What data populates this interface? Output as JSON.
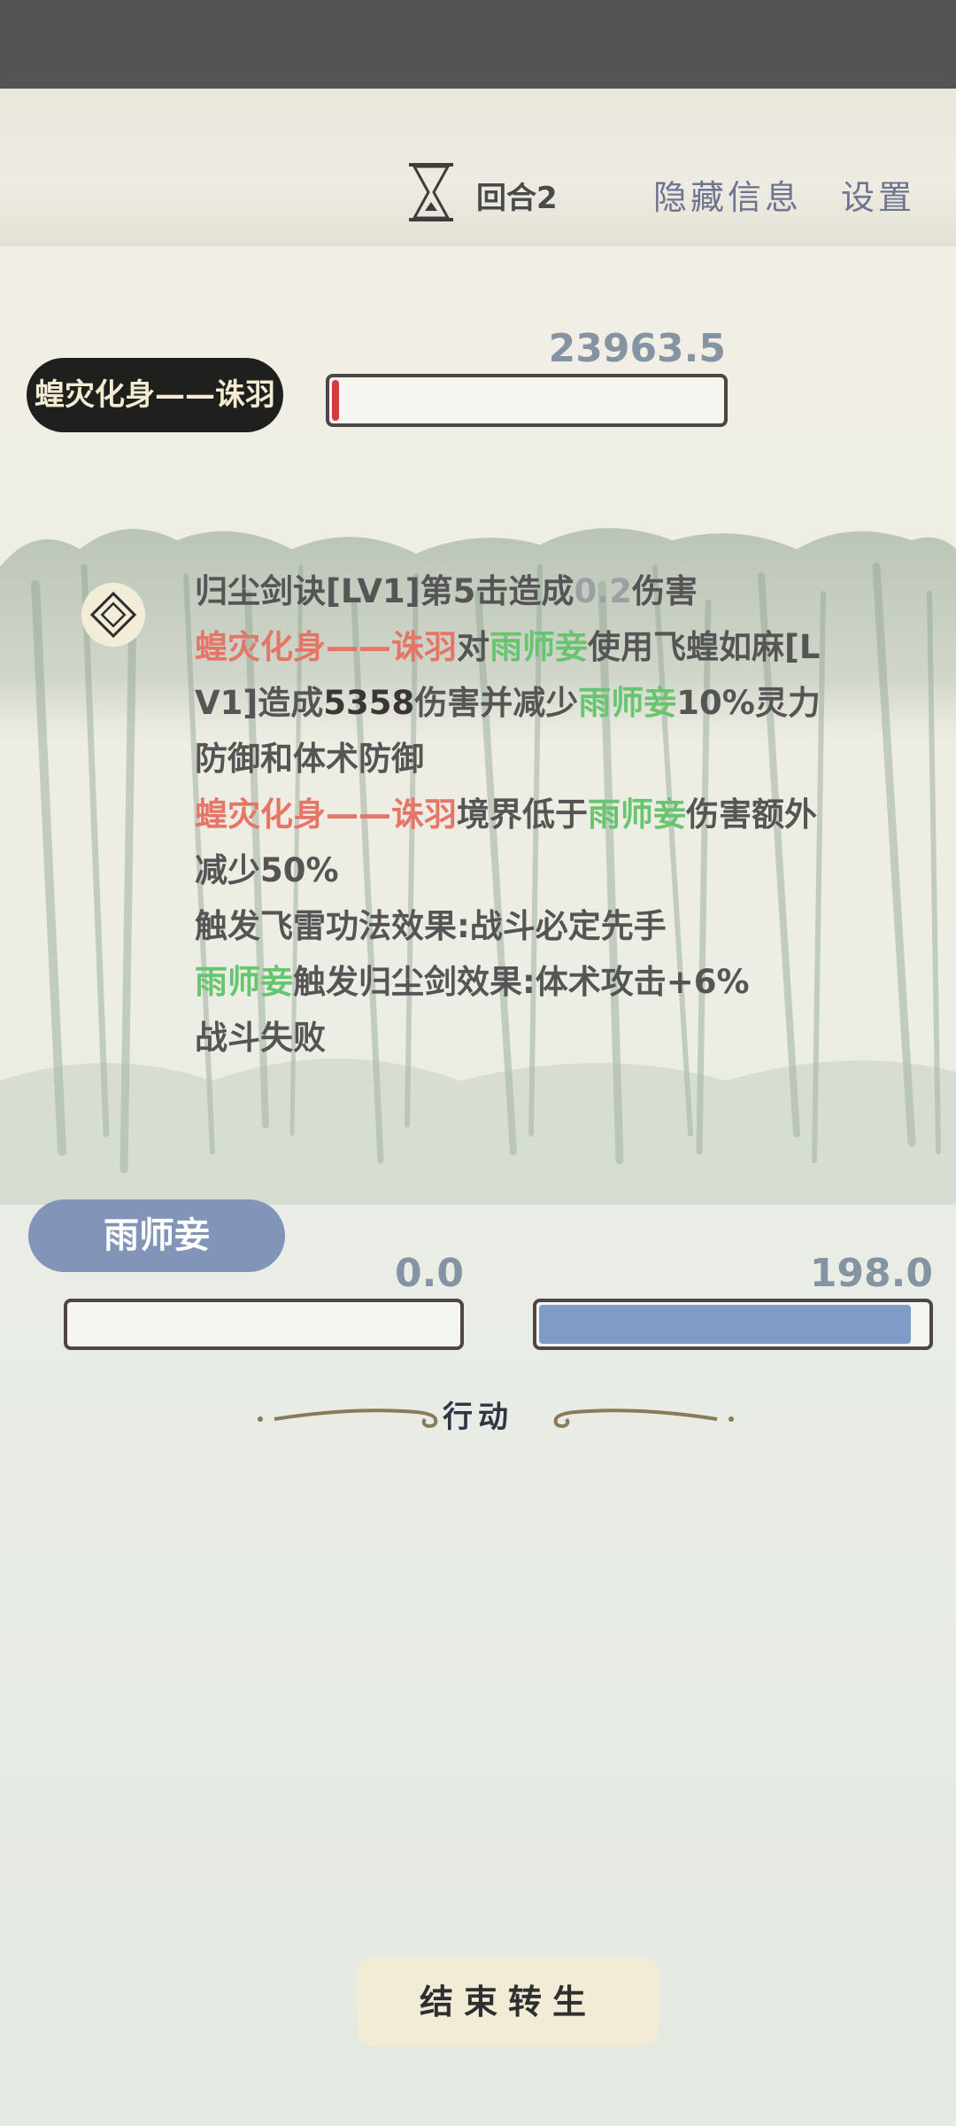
{
  "header": {
    "round_label": "回合2",
    "hide_info": "隐藏信息",
    "settings": "设置"
  },
  "enemy": {
    "name": "蝗灾化身——诛羽",
    "hp_value": "23963.5",
    "hp_fraction": 0.01
  },
  "battle_log": [
    [
      {
        "t": "归尘剑诀[LV1]第5击造成",
        "c": ""
      },
      {
        "t": "0.2",
        "c": "faint"
      },
      {
        "t": "伤害",
        "c": ""
      }
    ],
    [
      {
        "t": "蝗灾化身——诛羽",
        "c": "red"
      },
      {
        "t": "对",
        "c": ""
      },
      {
        "t": "雨师妾",
        "c": "green"
      },
      {
        "t": "使用飞蝗如麻[L",
        "c": ""
      }
    ],
    [
      {
        "t": "V1]造成",
        "c": ""
      },
      {
        "t": "5358",
        "c": "dark"
      },
      {
        "t": "伤害并减少",
        "c": ""
      },
      {
        "t": "雨师妾",
        "c": "green"
      },
      {
        "t": "10%灵力",
        "c": ""
      }
    ],
    [
      {
        "t": "防御和体术防御",
        "c": ""
      }
    ],
    [
      {
        "t": "蝗灾化身——诛羽",
        "c": "red"
      },
      {
        "t": "境界低于",
        "c": ""
      },
      {
        "t": "雨师妾",
        "c": "green"
      },
      {
        "t": "伤害额外",
        "c": ""
      }
    ],
    [
      {
        "t": "减少50%",
        "c": ""
      }
    ],
    [
      {
        "t": "触发飞雷功法效果:战斗必定先手",
        "c": ""
      }
    ],
    [
      {
        "t": "雨师妾",
        "c": "green"
      },
      {
        "t": "触发归尘剑效果:体术攻击+6%",
        "c": ""
      }
    ],
    [
      {
        "t": "战斗失败",
        "c": ""
      }
    ]
  ],
  "player": {
    "name": "雨师妾",
    "hp_value": "0.0",
    "hp_fraction": 0.0,
    "mp_value": "198.0",
    "mp_fraction": 0.96
  },
  "actions": {
    "section_label": "行动",
    "end_button": "结束转生"
  },
  "colors": {
    "enemy_hp": "#d43b3b",
    "player_mp": "#7f9bc6",
    "name_red": "#e57567",
    "name_green": "#67c46f"
  }
}
